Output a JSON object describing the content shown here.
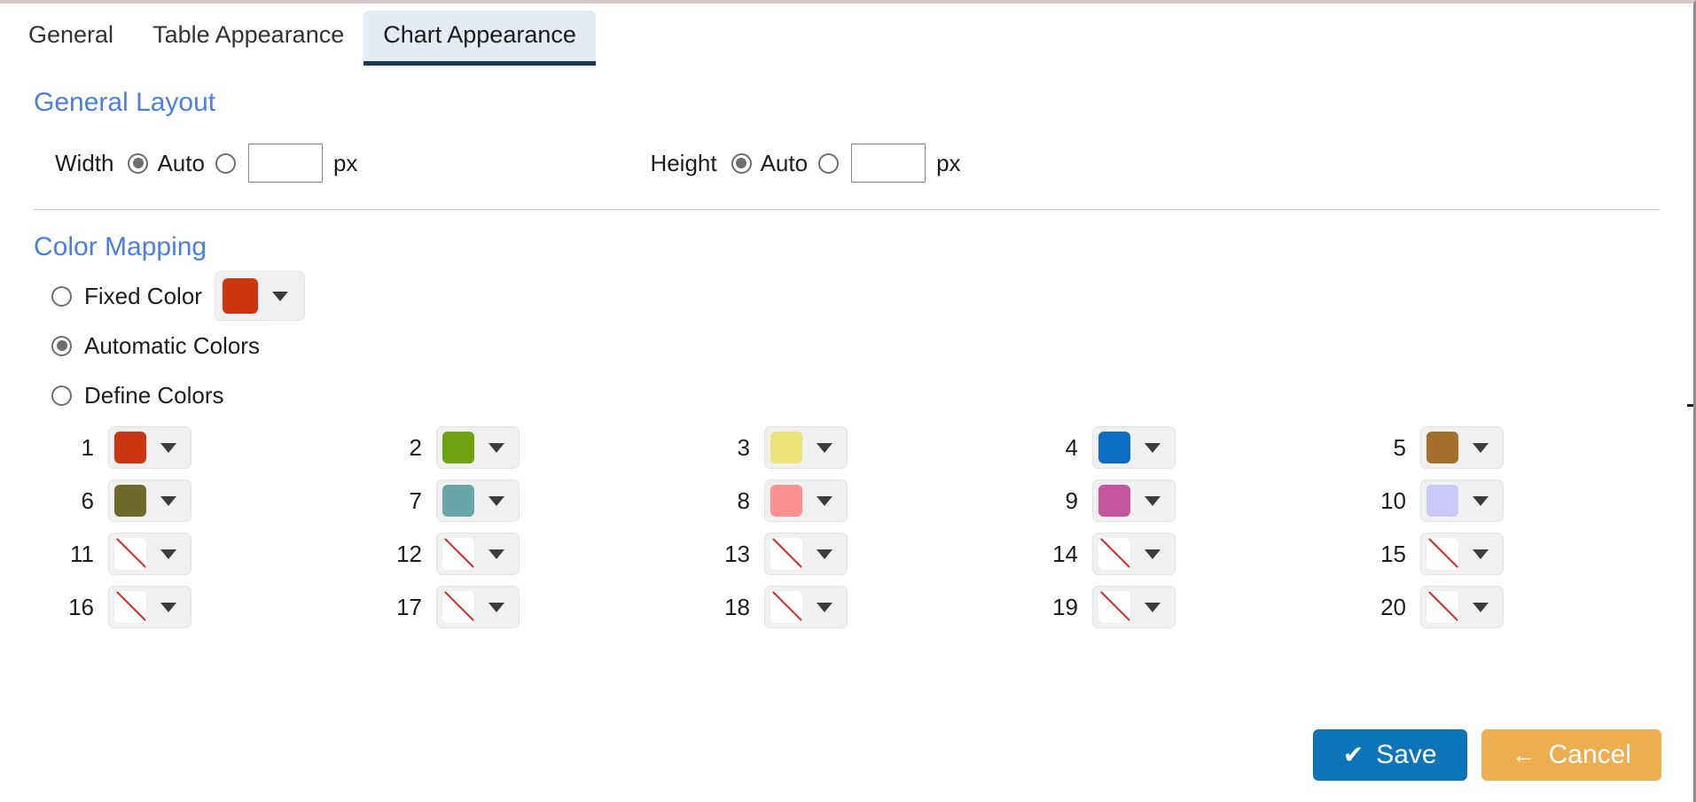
{
  "tabs": [
    {
      "label": "General",
      "active": false
    },
    {
      "label": "Table Appearance",
      "active": false
    },
    {
      "label": "Chart Appearance",
      "active": true
    }
  ],
  "general_layout": {
    "title": "General Layout",
    "width": {
      "label": "Width",
      "auto_label": "Auto",
      "auto_selected": true,
      "custom_selected": false,
      "value": "",
      "placeholder": "",
      "unit": "px"
    },
    "height": {
      "label": "Height",
      "auto_label": "Auto",
      "auto_selected": true,
      "custom_selected": false,
      "value": "",
      "placeholder": "",
      "unit": "px"
    }
  },
  "color_mapping": {
    "title": "Color Mapping",
    "options": [
      {
        "label": "Fixed Color",
        "selected": false,
        "has_picker": true,
        "color": "#cc3711"
      },
      {
        "label": "Automatic Colors",
        "selected": true,
        "has_picker": false
      },
      {
        "label": "Define Colors",
        "selected": false,
        "has_picker": false
      }
    ],
    "swatches": [
      {
        "index": "1",
        "color": "#cc3711"
      },
      {
        "index": "2",
        "color": "#6ea30f"
      },
      {
        "index": "3",
        "color": "#eee378"
      },
      {
        "index": "4",
        "color": "#0b6cc4"
      },
      {
        "index": "5",
        "color": "#a5702c"
      },
      {
        "index": "6",
        "color": "#6b6a2b"
      },
      {
        "index": "7",
        "color": "#67a5a6"
      },
      {
        "index": "8",
        "color": "#fb9090"
      },
      {
        "index": "9",
        "color": "#c4569f"
      },
      {
        "index": "10",
        "color": "#c9c8f6"
      },
      {
        "index": "11",
        "color": null
      },
      {
        "index": "12",
        "color": null
      },
      {
        "index": "13",
        "color": null
      },
      {
        "index": "14",
        "color": null
      },
      {
        "index": "15",
        "color": null
      },
      {
        "index": "16",
        "color": null
      },
      {
        "index": "17",
        "color": null
      },
      {
        "index": "18",
        "color": null
      },
      {
        "index": "19",
        "color": null
      },
      {
        "index": "20",
        "color": null
      }
    ]
  },
  "footer": {
    "save_label": "Save",
    "save_icon": "check-icon",
    "save_glyph": "✔",
    "save_color": "#0e76b8",
    "cancel_label": "Cancel",
    "cancel_icon": "arrow-left-icon",
    "cancel_glyph": "←",
    "cancel_color": "#efad51"
  },
  "theme": {
    "section_title_color": "#4a7fe0",
    "active_tab_bg": "#e4ebf2",
    "active_tab_underline": "#1d3557",
    "empty_swatch_slash": "#e32020"
  }
}
